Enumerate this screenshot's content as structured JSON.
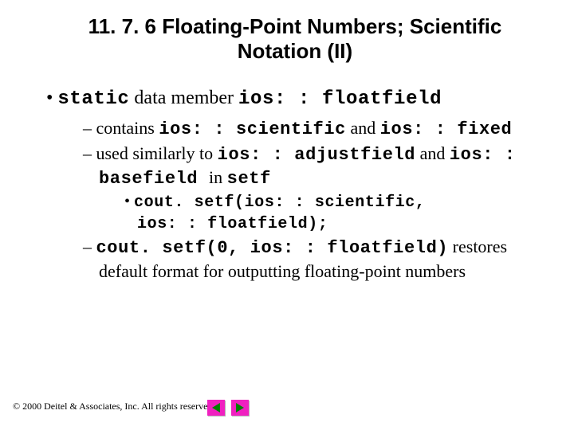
{
  "title_line1": "11. 7. 6  Floating-Point Numbers; Scientific",
  "title_line2": "Notation (II)",
  "b1_pre": "static",
  "b1_mid": " data member ",
  "b1_post": "ios: : floatfield",
  "b2_pre": "contains ",
  "b2_code1": "ios: : scientific",
  "b2_mid": " and ",
  "b2_code2": "ios: : fixed",
  "b3_pre": "used similarly to ",
  "b3_code1": "ios: : adjustfield",
  "b3_mid": " and ",
  "b3_code2": "ios: : basefield ",
  "b3_post_pre": " in ",
  "b3_code3": "setf",
  "b4_line1": "cout. setf(ios: : scientific,",
  "b4_line2": "ios: : floatfield);",
  "b5_code": "cout. setf(0, ios: : floatfield)",
  "b5_post": " restores default format for outputting floating-point numbers",
  "footer": "© 2000 Deitel & Associates, Inc.  All rights reserved."
}
